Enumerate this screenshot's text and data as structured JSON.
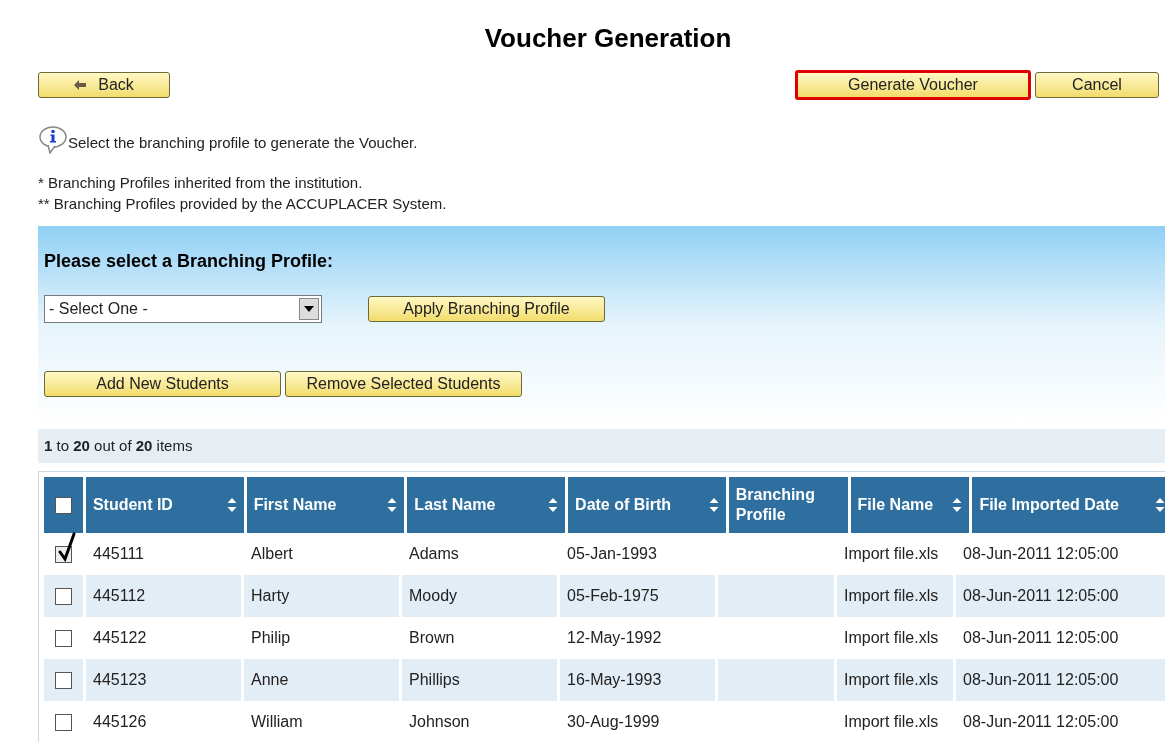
{
  "title": "Voucher Generation",
  "top_buttons": [
    {
      "label": "Back",
      "kind": "back",
      "highlighted": false
    },
    {
      "label": "Generate Voucher",
      "kind": "action",
      "highlighted": true
    },
    {
      "label": "Cancel",
      "kind": "action",
      "highlighted": false
    }
  ],
  "info": "Select the branching profile to generate the Voucher.",
  "notes": [
    "* Branching Profiles inherited from the institution.",
    "** Branching Profiles provided by the ACCUPLACER System."
  ],
  "profile_panel": {
    "heading": "Please select a Branching Profile:",
    "select": {
      "value": "- Select One -"
    },
    "apply_button": "Apply Branching Profile",
    "buttons": [
      "Add New Students",
      "Remove Selected Students"
    ]
  },
  "pager": "**1** to **20** out of **20** items",
  "table": {
    "all_checked": false,
    "columns": [
      {
        "label": "Student ID",
        "sortable": true
      },
      {
        "label": "First Name",
        "sortable": true
      },
      {
        "label": "Last Name",
        "sortable": true
      },
      {
        "label": "Date of Birth",
        "sortable": true
      },
      {
        "label": "Branching Profile",
        "sortable": false
      },
      {
        "label": "File Name",
        "sortable": true
      },
      {
        "label": "File Imported Date",
        "sortable": true
      }
    ],
    "rows": [
      {
        "checked": true,
        "cells": [
          "445111",
          "Albert",
          "Adams",
          "05-Jan-1993",
          "",
          "Import file.xls",
          "08-Jun-2011 12:05:00"
        ]
      },
      {
        "checked": false,
        "cells": [
          "445112",
          "Harty",
          "Moody",
          "05-Feb-1975",
          "",
          "Import file.xls",
          "08-Jun-2011 12:05:00"
        ]
      },
      {
        "checked": false,
        "cells": [
          "445122",
          "Philip",
          "Brown",
          "12-May-1992",
          "",
          "Import file.xls",
          "08-Jun-2011 12:05:00"
        ]
      },
      {
        "checked": false,
        "cells": [
          "445123",
          "Anne",
          "Phillips",
          "16-May-1993",
          "",
          "Import file.xls",
          "08-Jun-2011 12:05:00"
        ]
      },
      {
        "checked": false,
        "cells": [
          "445126",
          "William",
          "Johnson",
          "30-Aug-1999",
          "",
          "Import file.xls",
          "08-Jun-2011 12:05:00"
        ]
      }
    ]
  }
}
